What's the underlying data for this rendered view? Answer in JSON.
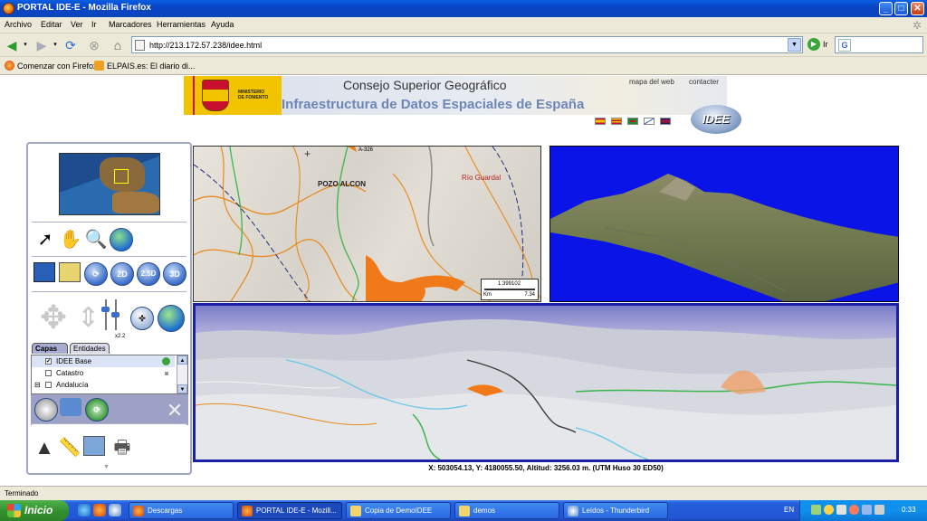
{
  "window": {
    "title": "PORTAL IDE-E - Mozilla Firefox",
    "controls": {
      "minimize": "_",
      "maximize": "□",
      "close": "✕"
    }
  },
  "menu": [
    "Archivo",
    "Editar",
    "Ver",
    "Ir",
    "Marcadores",
    "Herramientas",
    "Ayuda"
  ],
  "nav": {
    "url": "http://213.172.57.238/idee.html",
    "go_label": "Ir"
  },
  "bookmarks": [
    {
      "label": "Comenzar con Firefox",
      "icon": "firefox-icon"
    },
    {
      "label": "ELPAIS.es: El diario di...",
      "icon": "rss-feed-icon"
    }
  ],
  "banner": {
    "ministry_line1": "MINISTERIO",
    "ministry_line2": "DE FOMENTO",
    "title": "Consejo Superior Geográfico",
    "subtitle": "Infraestructura de Datos Espaciales de España",
    "links": {
      "sitemap": "mapa del web",
      "contact": "contacter"
    },
    "logo_text": "IDEE"
  },
  "tools": {
    "view_buttons": [
      "2D",
      "2.5D",
      "3D"
    ],
    "zoom_label": "x2.2",
    "tabs": [
      "Capas",
      "Entidades"
    ],
    "layers": [
      {
        "label": "IDEE Base",
        "checked": true
      },
      {
        "label": "Catastro",
        "checked": false
      },
      {
        "label": "Andalucía",
        "checked": false,
        "expander": "⊟"
      }
    ]
  },
  "map2d": {
    "places": [
      "POZO ALCON",
      "Río Guardal",
      "A-326"
    ],
    "scale": {
      "ratio": "1:399102",
      "unit": "Km",
      "value": "7.34"
    }
  },
  "coordinates": "X: 503054.13, Y: 4180055.50, Altitud: 3256.03 m. (UTM Huso 30 ED50)",
  "status": "Terminado",
  "taskbar": {
    "start": "Inicio",
    "tasks": [
      {
        "label": "Descargas",
        "active": false
      },
      {
        "label": "PORTAL IDE-E - Mozill...",
        "active": true
      },
      {
        "label": "Copia de DemoIDEE",
        "active": false
      },
      {
        "label": "demos",
        "active": false
      },
      {
        "label": "Leídos - Thunderbird",
        "active": false
      }
    ],
    "lang": "EN",
    "clock": "0:33"
  },
  "colors": {
    "xp_blue": "#0844c4",
    "map3d_bg": "#0b14e6",
    "road_orange": "#f07a1a",
    "start_green": "#34922f"
  }
}
